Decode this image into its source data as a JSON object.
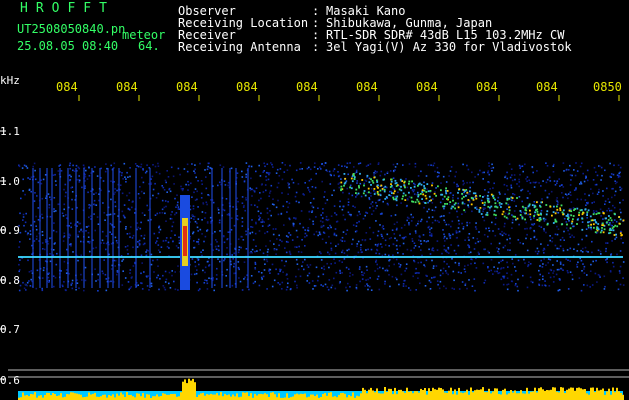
{
  "header": {
    "logo": "HROFFT",
    "filename": "UT2508050840.pn",
    "filename_suffix": "meteor",
    "datetime": "25.08.05 08:40",
    "index": "64.",
    "fields": [
      {
        "label": "Observer",
        "value": "Masaki Kano"
      },
      {
        "label": "Receiving Location",
        "value": "Shibukawa, Gunma, Japan"
      },
      {
        "label": "Receiver",
        "value": "RTL-SDR SDR# 43dB L15 103.2MHz CW"
      },
      {
        "label": "Receiving Antenna",
        "value": "3el Yagi(V) Az 330 for Vladivostok"
      }
    ]
  },
  "spectrogram": {
    "y_unit": "kHz",
    "y_ticks": [
      "1.1",
      "1.0",
      "0.9",
      "0.8",
      "0.7",
      "0.6"
    ],
    "x_ticks": [
      "084",
      "084",
      "084",
      "084",
      "084",
      "084",
      "084",
      "084",
      "084",
      "0850"
    ],
    "colors": {
      "grid": "#e6e600",
      "level": "#00c8ff",
      "burst": "#ffd700",
      "background": "#000000"
    }
  }
}
